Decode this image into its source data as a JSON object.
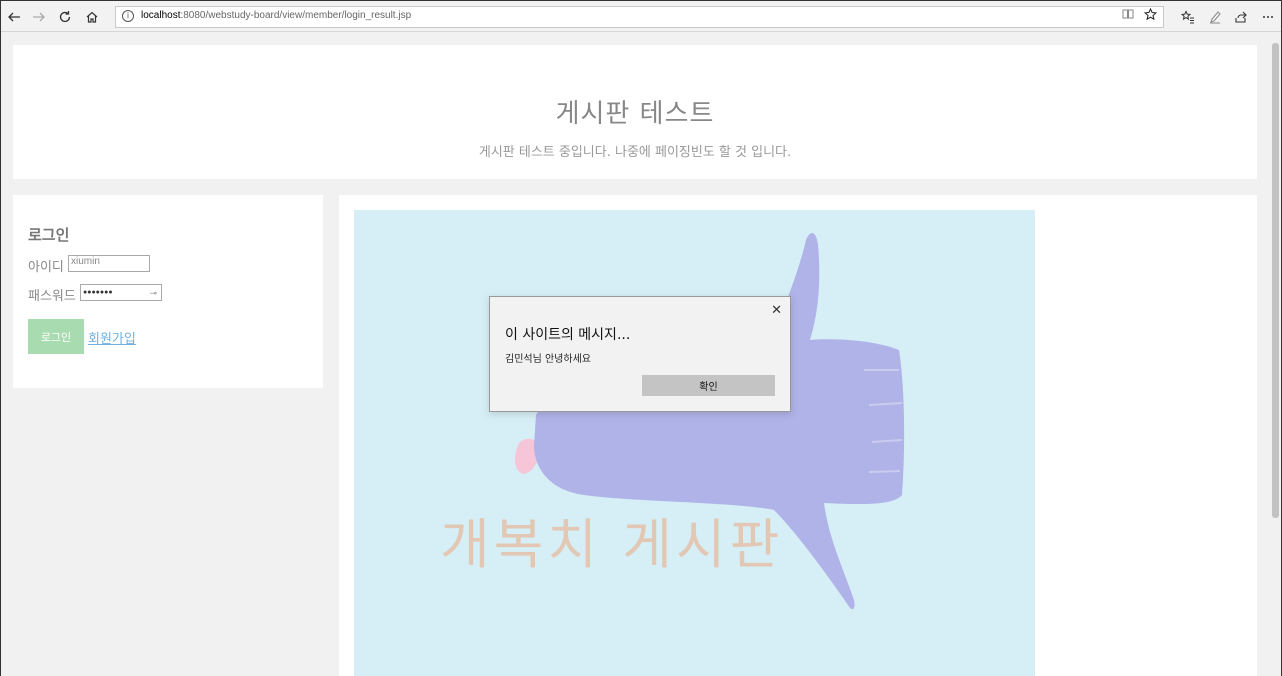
{
  "browser": {
    "url_host": "localhost",
    "url_rest": ":8080/webstudy-board/view/member/login_result.jsp"
  },
  "header": {
    "title": "게시판 테스트",
    "subtitle": "게시판 테스트 중입니다. 나중에 페이징빈도 할 것 입니다."
  },
  "login": {
    "title": "로그인",
    "id_label": "아이디",
    "id_value": "xiumin",
    "pw_label": "패스워드",
    "pw_value": "●●●●●●●",
    "login_button": "로그인",
    "signup_link": "회원가입"
  },
  "main": {
    "art_text": "개복치 게시판"
  },
  "dialog": {
    "title": "이 사이트의 메시지...",
    "message": "김민석님 안녕하세요",
    "ok_button": "확인"
  },
  "colors": {
    "canvas_bg": "#d6eff6",
    "fish": "#b0b3e8",
    "login_button": "#a8dbb0",
    "link": "#6fb0e0"
  }
}
